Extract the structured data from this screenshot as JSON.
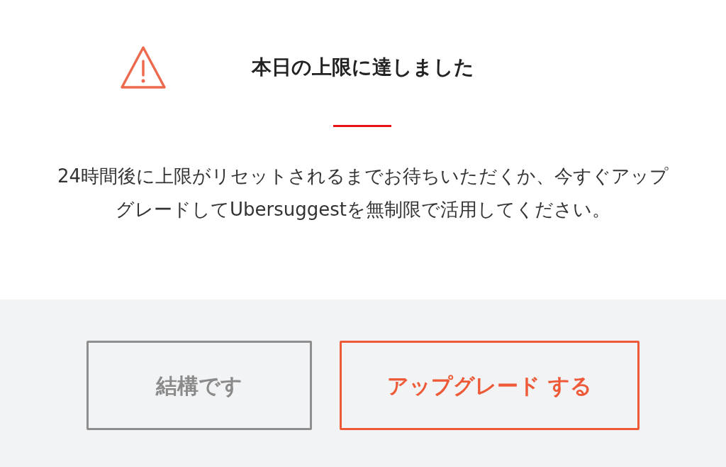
{
  "dialog": {
    "title": "本日の上限に達しました",
    "message": "24時間後に上限がリセットされるまでお待ちいただくか、今すぐアップグレードしてUbersuggestを無制限で活用してください。",
    "buttons": [
      {
        "label": "結構です",
        "kind": "secondary"
      },
      {
        "label": "アップグレード する",
        "kind": "primary"
      }
    ]
  }
}
